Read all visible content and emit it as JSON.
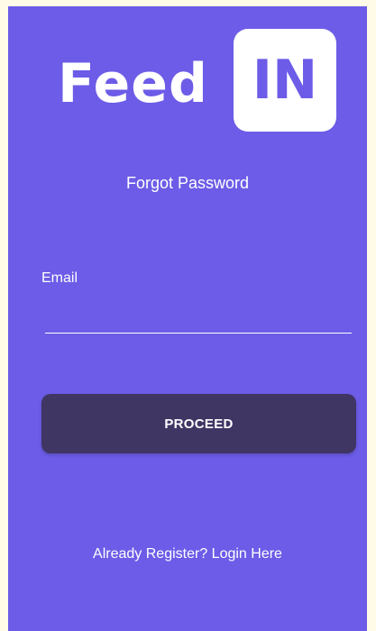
{
  "app": {
    "logo_word": "Feed",
    "logo_box_text": "IN"
  },
  "page": {
    "title": "Forgot Password"
  },
  "form": {
    "email_label": "Email",
    "email_value": "",
    "email_placeholder": ""
  },
  "actions": {
    "proceed_label": "PROCEED",
    "login_link_label": "Already Register? Login Here"
  },
  "colors": {
    "screen_background": "#6c5ce7",
    "button_background": "#3f3664",
    "text": "#ffffff",
    "outer_background": "#fffbe6"
  }
}
